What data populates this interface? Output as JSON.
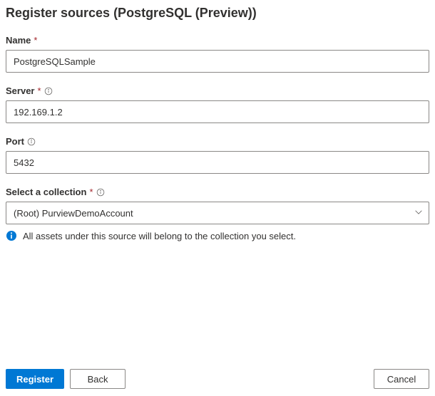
{
  "title": "Register sources (PostgreSQL (Preview))",
  "fields": {
    "name": {
      "label": "Name",
      "value": "PostgreSQLSample"
    },
    "server": {
      "label": "Server",
      "value": "192.169.1.2"
    },
    "port": {
      "label": "Port",
      "value": "5432"
    },
    "collection": {
      "label": "Select a collection",
      "value": "(Root) PurviewDemoAccount"
    }
  },
  "hint": "All assets under this source will belong to the collection you select.",
  "buttons": {
    "register": "Register",
    "back": "Back",
    "cancel": "Cancel"
  }
}
